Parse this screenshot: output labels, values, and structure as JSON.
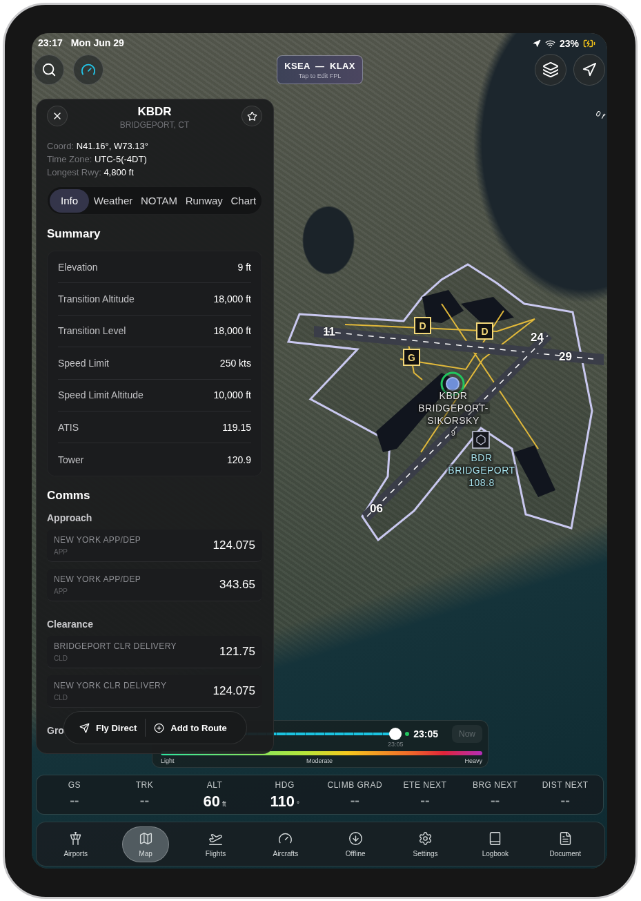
{
  "status_bar": {
    "time": "23:17",
    "date": "Mon Jun 29",
    "battery": "23%"
  },
  "flight_plan": {
    "route": "KSEA  —  KLAX",
    "hint": "Tap to Edit FPL"
  },
  "map": {
    "edge_label": "0 f",
    "taxiway_signs": [
      "D",
      "D",
      "G"
    ],
    "runway_labels": [
      "11",
      "24",
      "29",
      "06"
    ],
    "airport_label": [
      "KBDR",
      "BRIDGEPORT-",
      "SIKORSKY",
      "9"
    ],
    "navaid_label": [
      "BDR",
      "BRIDGEPORT",
      "108.8"
    ]
  },
  "airport_panel": {
    "code": "KBDR",
    "city": "BRIDGEPORT, CT",
    "facts": [
      {
        "label": "Coord:",
        "value": "N41.16°, W73.13°"
      },
      {
        "label": "Time Zone:",
        "value": "UTC-5(-4DT)"
      },
      {
        "label": "Longest Rwy:",
        "value": "4,800 ft"
      }
    ],
    "tabs": [
      {
        "label": "Info",
        "selected": true
      },
      {
        "label": "Weather",
        "selected": false
      },
      {
        "label": "NOTAM",
        "selected": false
      },
      {
        "label": "Runway",
        "selected": false
      },
      {
        "label": "Chart",
        "selected": false
      }
    ],
    "summary_title": "Summary",
    "summary": [
      {
        "label": "Elevation",
        "value": "9 ft"
      },
      {
        "label": "Transition Altitude",
        "value": "18,000 ft"
      },
      {
        "label": "Transition Level",
        "value": "18,000 ft"
      },
      {
        "label": "Speed Limit",
        "value": "250 kts"
      },
      {
        "label": "Speed Limit Altitude",
        "value": "10,000 ft"
      },
      {
        "label": "ATIS",
        "value": "119.15"
      },
      {
        "label": "Tower",
        "value": "120.9"
      }
    ],
    "comms_title": "Comms",
    "comm_groups": [
      {
        "title": "Approach",
        "entries": [
          {
            "name": "NEW YORK APP/DEP",
            "type": "APP",
            "frequency": "124.075"
          },
          {
            "name": "NEW YORK APP/DEP",
            "type": "APP",
            "frequency": "343.65"
          }
        ]
      },
      {
        "title": "Clearance",
        "entries": [
          {
            "name": "BRIDGEPORT CLR DELIVERY",
            "type": "CLD",
            "frequency": "121.75"
          },
          {
            "name": "NEW YORK CLR DELIVERY",
            "type": "CLD",
            "frequency": "124.075"
          }
        ]
      },
      {
        "title": "Gro"
      }
    ]
  },
  "action_menu": [
    {
      "kind": "direct",
      "label": "Fly Direct"
    },
    {
      "kind": "add",
      "label": "Add to Route"
    }
  ],
  "timeline": {
    "level": 1,
    "tick_label": "23:05",
    "current_time": "23:05",
    "now_button": "Now",
    "legend": [
      "Light",
      "Moderate",
      "Heavy"
    ]
  },
  "instruments": [
    {
      "label": "GS",
      "value": "--"
    },
    {
      "label": "TRK",
      "value": "--"
    },
    {
      "label": "ALT",
      "value": "60",
      "unit": "ft"
    },
    {
      "label": "HDG",
      "value": "110",
      "unit": "°"
    },
    {
      "label": "CLIMB GRAD",
      "value": "--"
    },
    {
      "label": "ETE NEXT",
      "value": "--"
    },
    {
      "label": "BRG NEXT",
      "value": "--"
    },
    {
      "label": "DIST NEXT",
      "value": "--"
    }
  ],
  "tab_bar": [
    {
      "label": "Airports",
      "selected": false
    },
    {
      "label": "Map",
      "selected": true
    },
    {
      "label": "Flights",
      "selected": false
    },
    {
      "label": "Aircrafts",
      "selected": false
    },
    {
      "label": "Offline",
      "selected": false
    },
    {
      "label": "Settings",
      "selected": false
    },
    {
      "label": "Logbook",
      "selected": false
    },
    {
      "label": "Document",
      "selected": false
    }
  ]
}
